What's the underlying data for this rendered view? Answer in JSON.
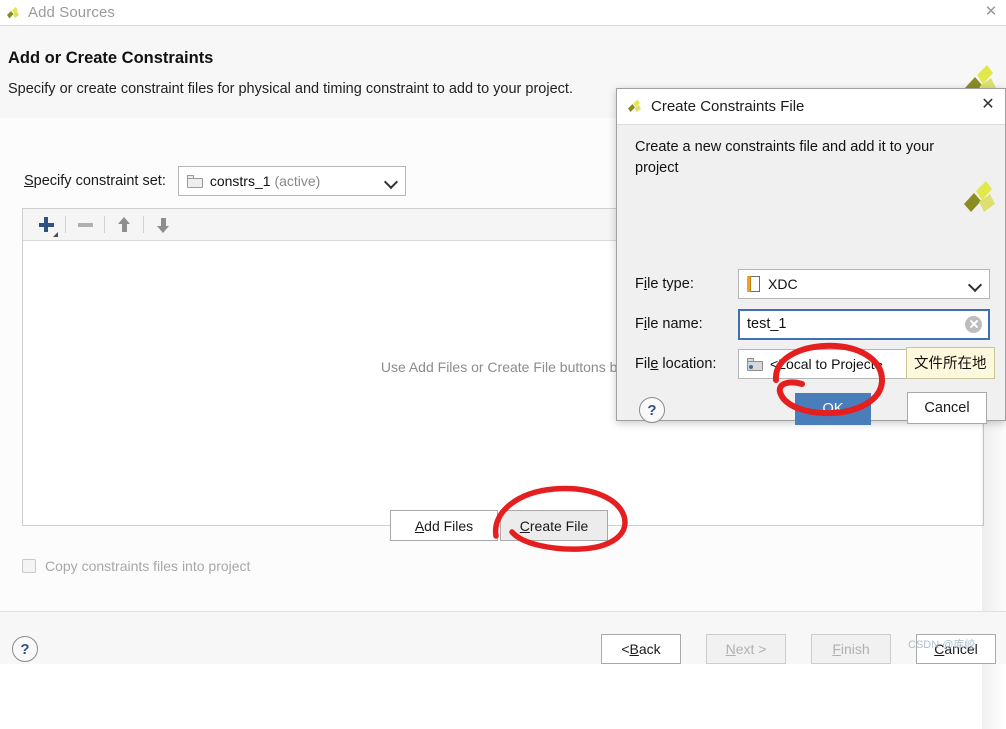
{
  "window": {
    "title": "Add Sources",
    "close_label": "✕",
    "logo_name": "xilinx-logo"
  },
  "header": {
    "title": "Add or Create Constraints",
    "subtitle": "Specify or create constraint files for physical and timing constraint to add to your project."
  },
  "constraint_set": {
    "label_prefix": "S",
    "label_rest": "pecify constraint set:",
    "value": "constrs_1",
    "value_suffix": "(active)"
  },
  "toolbar": {
    "add_icon": "plus-icon",
    "remove_icon": "minus-icon",
    "move_up_icon": "arrow-up-icon",
    "move_down_icon": "arrow-down-icon"
  },
  "file_list": {
    "empty_message": "Use Add Files or Create File buttons be"
  },
  "mid_buttons": {
    "add_files_accel": "A",
    "add_files_rest": "dd Files",
    "create_file_accel": "C",
    "create_file_rest": "reate File"
  },
  "copy_option": {
    "label": "Copy constraints files into project",
    "checked": false
  },
  "footer": {
    "help_glyph": "?",
    "back_accel": "B",
    "back_prefix": "< ",
    "back_rest": "ack",
    "next_accel": "N",
    "next_rest": "ext >",
    "finish_accel": "F",
    "finish_rest": "inish",
    "cancel_accel": "C",
    "cancel_rest": "ancel"
  },
  "dialog": {
    "title": "Create Constraints File",
    "close_label": "✕",
    "description": "Create a new constraints file and add it to your project",
    "help_glyph": "?",
    "fields": {
      "file_type": {
        "label_prefix": "F",
        "label_accel": "i",
        "label_rest": "le type:",
        "value": "XDC",
        "icon": "xdc-file-icon"
      },
      "file_name": {
        "label_prefix": "F",
        "label_accel": "i",
        "label_rest": "le name:",
        "value": "test_1",
        "clear_icon": "clear-icon"
      },
      "file_location": {
        "label_prefix": "Fil",
        "label_accel": "e",
        "label_rest": " location:",
        "value": "<Local to Project>",
        "icon": "folder-icon"
      }
    },
    "ok_label": "OK",
    "cancel_label": "Cancel"
  },
  "tooltip": {
    "text": "文件所在地"
  },
  "watermark": {
    "text": "CSDN @库峧"
  },
  "colors": {
    "primary_button": "#4a7ebb",
    "annotation_ink": "#e51f1f",
    "accent_plus": "#2f5283",
    "tooltip_bg": "#fcf8dc",
    "focus_border": "#3f6fb5"
  }
}
